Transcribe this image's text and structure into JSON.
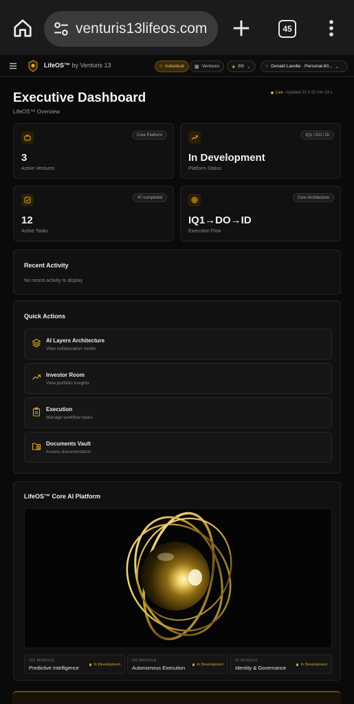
{
  "browser": {
    "url": "venturis13lifeos.com",
    "tab_count": "45"
  },
  "nav": {
    "brand_name": "LifeOS™",
    "brand_by": "by Venturis 13",
    "pills": [
      {
        "label": "Individual",
        "active": true,
        "icon": "user-icon"
      },
      {
        "label": "Ventures",
        "active": false,
        "icon": "building-icon"
      },
      {
        "label": "BB",
        "active": false,
        "icon": "tag-icon"
      },
      {
        "label": "Donald Lavolle · Personal-60...",
        "active": false,
        "icon": "user-icon"
      }
    ]
  },
  "header": {
    "title": "Executive Dashboard",
    "subtitle": "LifeOS™ Overview",
    "live_label": "Live",
    "updated": "Updated 22 h 52 min 33 s"
  },
  "stats": [
    {
      "badge": "Core Platform",
      "value": "3",
      "label": "Active Ventures",
      "icon": "briefcase-icon"
    },
    {
      "badge": "IQ1 / DO / ID",
      "value": "In Development",
      "label": "Platform Status",
      "icon": "trending-up-icon"
    },
    {
      "badge": "47 completed",
      "value": "12",
      "label": "Active Tasks",
      "icon": "checkbox-icon"
    },
    {
      "badge": "Core Architecture",
      "value": "IQ1→DO→ID",
      "label": "Execution Flow",
      "icon": "target-icon"
    }
  ],
  "recent_activity": {
    "title": "Recent Activity",
    "empty": "No recent activity to display"
  },
  "quick_actions": {
    "title": "Quick Actions",
    "items": [
      {
        "title": "AI Layers Architecture",
        "subtitle": "View collaboration model",
        "icon": "layers-icon"
      },
      {
        "title": "Investor Room",
        "subtitle": "View portfolio insights",
        "icon": "trending-up-icon"
      },
      {
        "title": "Execution",
        "subtitle": "Manage workflow tasks",
        "icon": "clipboard-icon"
      },
      {
        "title": "Documents Vault",
        "subtitle": "Access documentation",
        "icon": "folder-lock-icon"
      }
    ]
  },
  "platform": {
    "title": "LifeOS™ Core AI Platform",
    "modules": [
      {
        "kicker": "IQ1 MODULE",
        "name": "Predictive Intelligence",
        "status": "In Development"
      },
      {
        "kicker": "DO MODULE",
        "name": "Autonomous Execution",
        "status": "In Development"
      },
      {
        "kicker": "ID MODULE",
        "name": "Identity & Governance",
        "status": "In Development"
      }
    ]
  },
  "colors": {
    "accent": "#e0a51e",
    "background": "#0a0a0a",
    "card": "#111111"
  }
}
